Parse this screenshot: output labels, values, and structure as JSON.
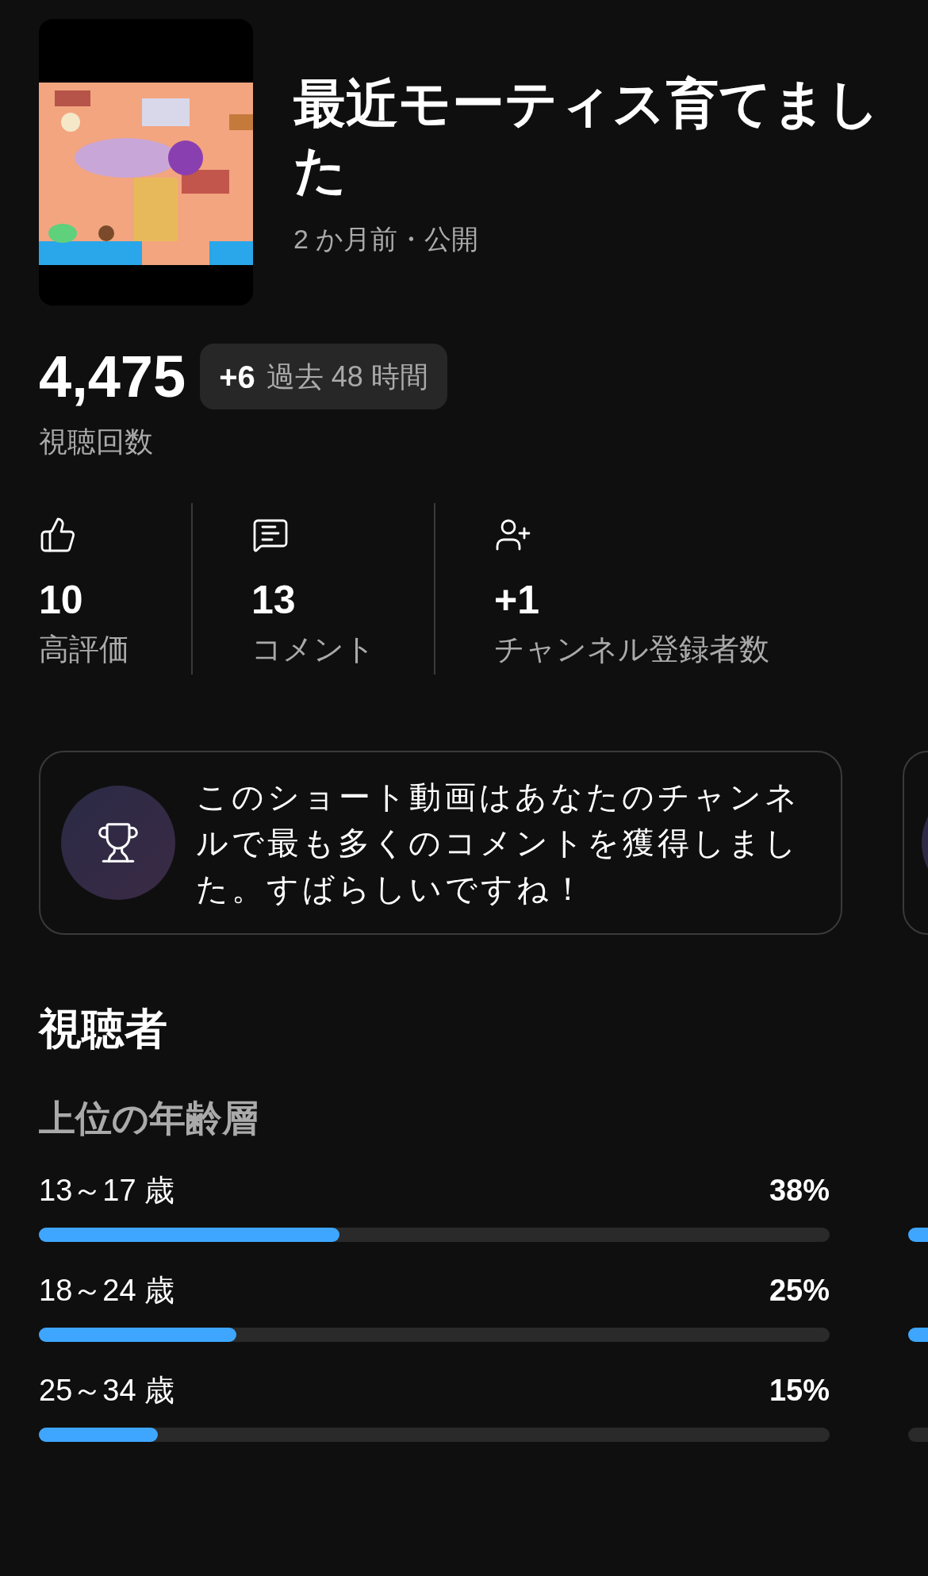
{
  "video": {
    "title": "最近モーティス育てました",
    "meta": "2 か月前・公開"
  },
  "views": {
    "count": "4,475",
    "delta": "+6",
    "delta_period": "過去 48 時間",
    "label": "視聴回数"
  },
  "stats": [
    {
      "kind": "likes",
      "value": "10",
      "label": "高評価"
    },
    {
      "kind": "comments",
      "value": "13",
      "label": "コメント"
    },
    {
      "kind": "subscribers",
      "value": "+1",
      "label": "チャンネル登録者数"
    }
  ],
  "highlight_cards": [
    {
      "kind": "trophy",
      "text": "このショート動画はあなたのチャンネルで最も多くのコメントを獲得しました。すばらしいですね！"
    },
    {
      "kind": "partial"
    }
  ],
  "audience": {
    "title": "視聴者",
    "age": {
      "title": "上位の年齢層",
      "rows": [
        {
          "label": "13～17 歳",
          "value": "38%",
          "level": 0.38
        },
        {
          "label": "18～24 歳",
          "value": "25%",
          "level": 0.25
        },
        {
          "label": "25～34 歳",
          "value": "15%",
          "level": 0.15
        }
      ]
    },
    "gender": {
      "rows": [
        {
          "filled": true
        },
        {
          "filled": true
        },
        {
          "filled": false
        }
      ]
    }
  }
}
